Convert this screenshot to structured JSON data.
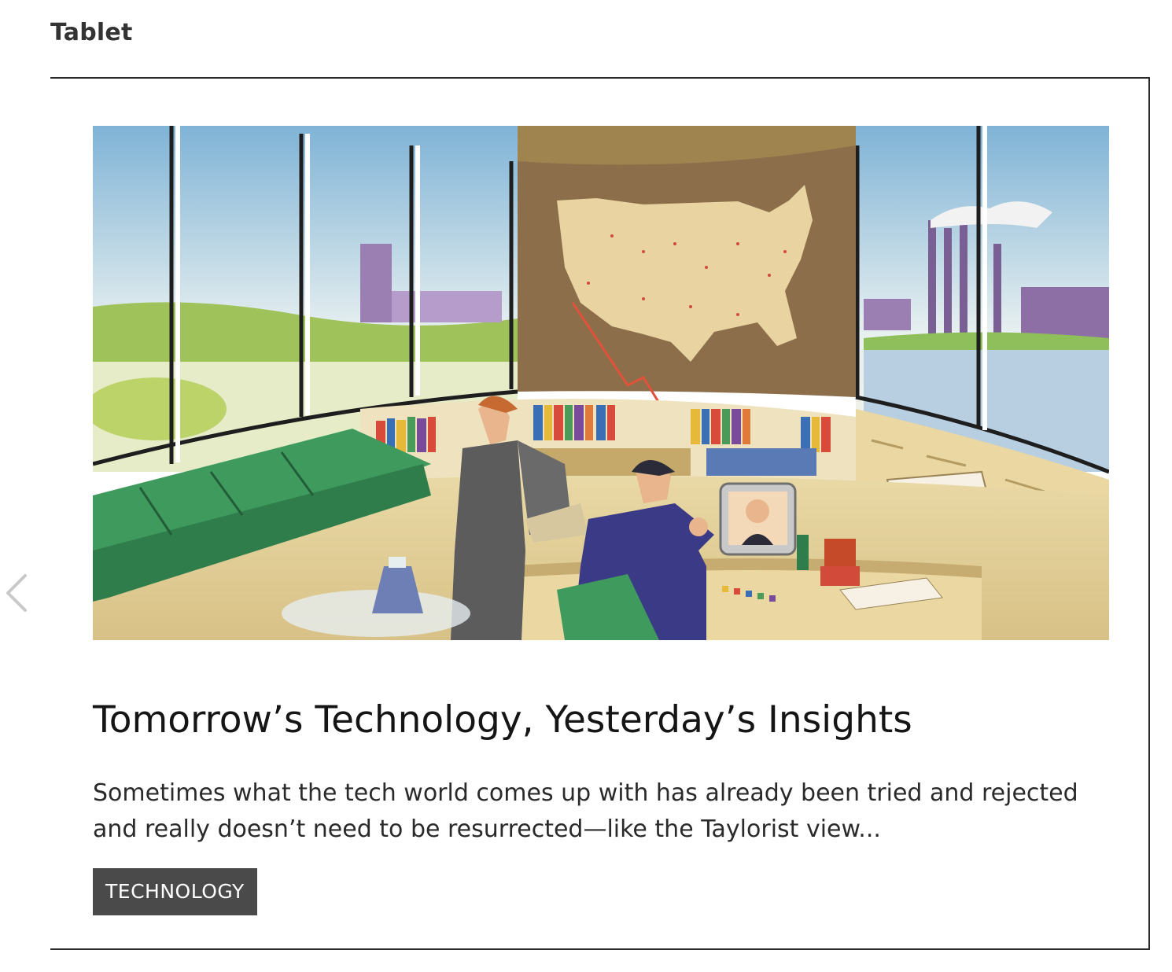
{
  "page": {
    "device_label": "Tablet"
  },
  "navigation": {
    "prev_icon": "chevron-left-icon"
  },
  "article": {
    "image_alt": "Retro illustration of a curved mid-century office with panoramic windows, a United States map on the wall, bookshelves, a green sofa, and two men at a desk using a video phone",
    "title": "Tomorrow’s Technology, Yesterday’s Insights",
    "excerpt": "Sometimes what the tech world comes up with has already been tried and rejected and really doesn’t need to be resurrected—like the Taylorist view...",
    "category": "TECHNOLOGY"
  },
  "colors": {
    "tag_background": "#4a4a4a",
    "tag_text": "#ffffff",
    "frame_border": "#2b2b2b",
    "arrow": "#c9c9c9"
  }
}
